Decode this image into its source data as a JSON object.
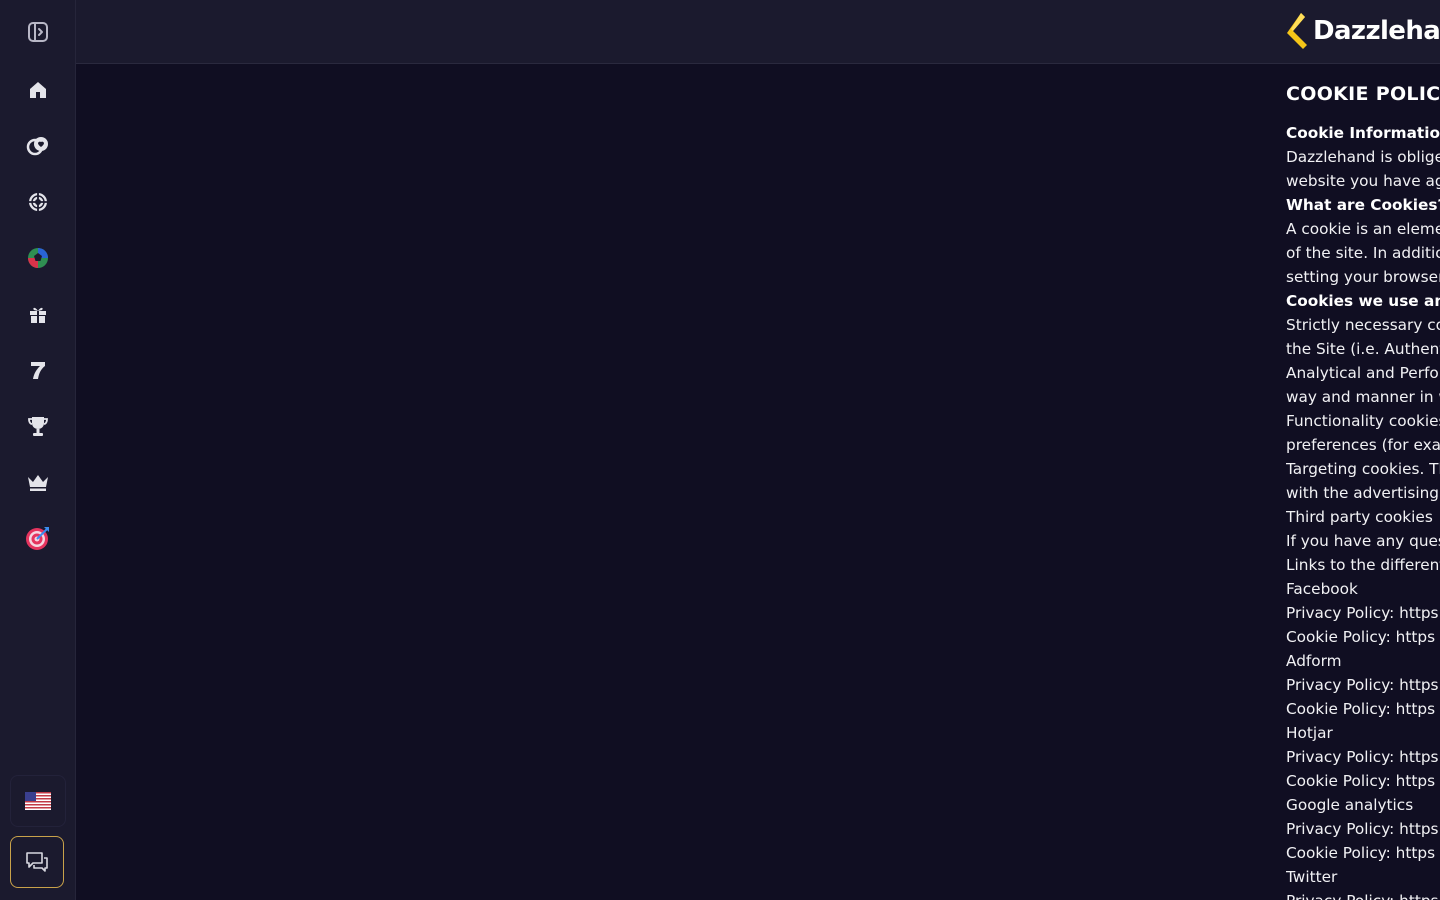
{
  "sidebar": {
    "items": [
      {
        "icon": "collapse-sidebar-icon"
      },
      {
        "icon": "home-icon"
      },
      {
        "icon": "casino-chips-icon"
      },
      {
        "icon": "sports-ball-icon"
      },
      {
        "icon": "live-sports-icon"
      },
      {
        "icon": "gift-icon"
      },
      {
        "icon": "slot-seven-icon"
      },
      {
        "icon": "trophy-icon"
      },
      {
        "icon": "crown-icon"
      },
      {
        "icon": "target-icon"
      }
    ],
    "language": {
      "icon": "us-flag-icon"
    },
    "chat": {
      "icon": "chat-icon"
    }
  },
  "header": {
    "logo_text": "Dazzlehand"
  },
  "policy": {
    "title": "COOKIE POLICY",
    "lines": [
      {
        "text": "Cookie Information",
        "bold": true
      },
      {
        "text": "Dazzlehand is obliged to",
        "bold": false
      },
      {
        "text": "website you have agreed",
        "bold": false
      },
      {
        "text": "What are Cookies?",
        "bold": true
      },
      {
        "text": "A cookie is an element of",
        "bold": false
      },
      {
        "text": "of the site. In addition",
        "bold": false
      },
      {
        "text": "setting your browser",
        "bold": false
      },
      {
        "text": "Cookies we use and",
        "bold": true
      },
      {
        "text": "Strictly necessary cookies",
        "bold": false
      },
      {
        "text": "the Site (i.e. Authentication",
        "bold": false
      },
      {
        "text": "Analytical and Performance",
        "bold": false
      },
      {
        "text": "way and manner in which",
        "bold": false
      },
      {
        "text": "Functionality cookies",
        "bold": false
      },
      {
        "text": "preferences (for example",
        "bold": false
      },
      {
        "text": "Targeting cookies. These",
        "bold": false
      },
      {
        "text": "with the advertising",
        "bold": false
      },
      {
        "text": "Third party cookies",
        "bold": false
      },
      {
        "text": "If you have any questions",
        "bold": false
      },
      {
        "text": "Links to the different",
        "bold": false
      },
      {
        "text": "Facebook",
        "bold": false
      },
      {
        "text": "Privacy Policy: https",
        "bold": false
      },
      {
        "text": "Cookie Policy: https",
        "bold": false
      },
      {
        "text": "Adform",
        "bold": false
      },
      {
        "text": "Privacy Policy: https",
        "bold": false
      },
      {
        "text": "Cookie Policy: https",
        "bold": false
      },
      {
        "text": "Hotjar",
        "bold": false
      },
      {
        "text": "Privacy Policy: https",
        "bold": false
      },
      {
        "text": "Cookie Policy: https",
        "bold": false
      },
      {
        "text": "Google analytics",
        "bold": false
      },
      {
        "text": "Privacy Policy: https",
        "bold": false
      },
      {
        "text": "Cookie Policy: https",
        "bold": false
      },
      {
        "text": "Twitter",
        "bold": false
      },
      {
        "text": "Privacy Policy: https",
        "bold": false
      }
    ]
  },
  "colors": {
    "page_bg": "#100e22",
    "sidebar_bg": "#1b1a2e",
    "accent_gold": "#f5c518",
    "chat_border": "#c9a24a"
  }
}
